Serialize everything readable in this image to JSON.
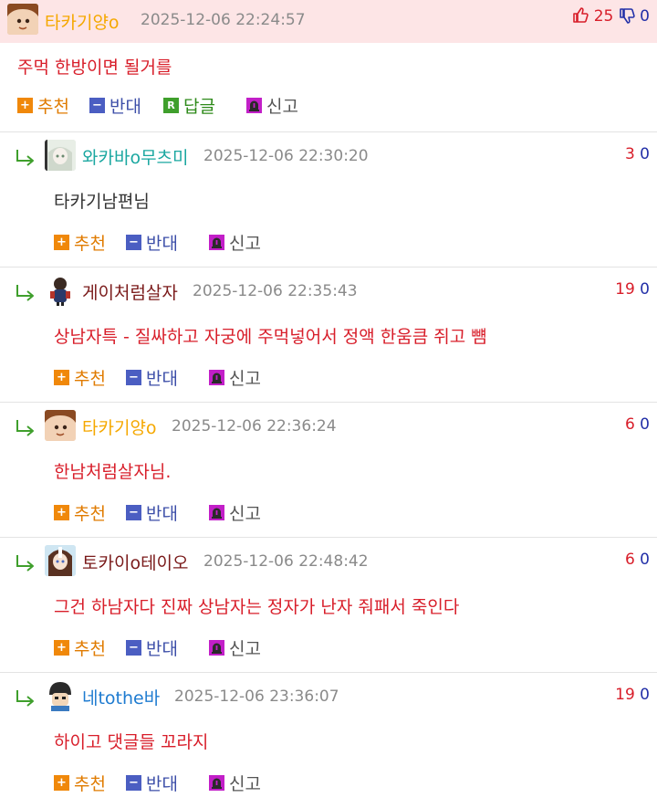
{
  "main": {
    "nick": "타카기양o",
    "date": "2025-12-06 22:24:57",
    "up": "25",
    "down": "0",
    "content": "주먹 한방이면 될거를",
    "actions": {
      "rec": "추천",
      "opp": "반대",
      "reply": "답글",
      "report": "신고"
    }
  },
  "replies": [
    {
      "nick": "와카바o무츠미",
      "date": "2025-12-06 22:30:20",
      "up": "3",
      "down": "0",
      "content": "타카기남편님",
      "nick_color": "#1aa7a0",
      "content_color": "#333333"
    },
    {
      "nick": "게이처럼살자",
      "date": "2025-12-06 22:35:43",
      "up": "19",
      "down": "0",
      "content": "상남자특 - 질싸하고 자궁에 주먹넣어서 정액 한움큼 쥐고 뻄",
      "nick_color": "#7a1a1a",
      "content_color": "#d81e2a"
    },
    {
      "nick": "타카기양o",
      "date": "2025-12-06 22:36:24",
      "up": "6",
      "down": "0",
      "content": "한남처럼살자님.",
      "nick_color": "#f5a800",
      "content_color": "#d81e2a"
    },
    {
      "nick": "토카이o테이오",
      "date": "2025-12-06 22:48:42",
      "up": "6",
      "down": "0",
      "content": "그건 하남자다 진짜 상남자는 정자가 난자 줘패서 죽인다",
      "nick_color": "#7a1a1a",
      "content_color": "#d81e2a"
    },
    {
      "nick": "네tothe바",
      "date": "2025-12-06 23:36:07",
      "up": "19",
      "down": "0",
      "content": "하이고 댓글들 꼬라지",
      "nick_color": "#1e7bd0",
      "content_color": "#d81e2a"
    }
  ],
  "reply_actions": {
    "rec": "추천",
    "opp": "반대",
    "report": "신고"
  },
  "colors": {
    "main_header_bg": "#fde5e6",
    "main_nick": "#f5a800",
    "upvote": "#d81e2a",
    "downvote": "#2330a8",
    "recommend": "#e07b00",
    "oppose": "#3c4ea8",
    "reply": "#2e8a1a",
    "report_icon": "#c21fc8"
  },
  "icons": {
    "up": "thumbs-up-icon",
    "down": "thumbs-down-icon",
    "reply_arrow": "reply-arrow-icon",
    "recommend": "plus-icon",
    "oppose": "minus-icon",
    "reply": "r-icon",
    "report": "siren-icon"
  }
}
